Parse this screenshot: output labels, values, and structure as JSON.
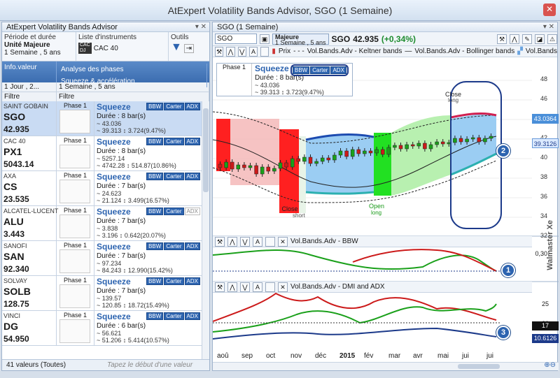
{
  "window": {
    "title": "AtExpert Volatility Bands Advisor, SGO (1 Semaine)"
  },
  "left": {
    "panel_title": "AtExpert Volatility Bands Advisor",
    "period_label": "Période et durée",
    "period_value1": "Unité Majeure",
    "period_value2": "1 Semaine , 5 ans",
    "instruments_label": "Liste d'instruments",
    "instrument_value": "CAC 40",
    "instrument_badge1": "CAC",
    "instrument_badge2": "DJ",
    "tools_label": "Outils",
    "col1": "Info.valeur",
    "col2a": "Analyse des phases",
    "col2b": "Squeeze & accélération",
    "sub1": "1 Jour , 2...",
    "sub2": "1 Semaine , 5 ans",
    "filter1": "Filtre",
    "filter2": "Filtre",
    "status": "41 valeurs (Toutes)",
    "hint": "Tapez le début d'une valeur",
    "phase_label": "Phase 1",
    "squeeze_label": "Squeeze",
    "tag_bbw": "BBW",
    "tag_carter": "Carter",
    "tag_adx": "ADX",
    "items": [
      {
        "name": "SAINT GOBAIN",
        "ticker": "SGO",
        "price": "42.935",
        "dur": "Durée : 8 bar(s)",
        "v1": "43.036",
        "v2": "39.313",
        "chg": "3.724(9.47%)"
      },
      {
        "name": "CAC 40",
        "ticker": "PX1",
        "price": "5043.14",
        "dur": "Durée : 8 bar(s)",
        "v1": "5257.14",
        "v2": "4742.28",
        "chg": "514.87(10.86%)"
      },
      {
        "name": "AXA",
        "ticker": "CS",
        "price": "23.535",
        "dur": "Durée : 7 bar(s)",
        "v1": "24.623",
        "v2": "21.124",
        "chg": "3.499(16.57%)"
      },
      {
        "name": "ALCATEL-LUCENT",
        "ticker": "ALU",
        "price": "3.443",
        "dur": "Durée : 7 bar(s)",
        "v1": "3.838",
        "v2": "3.196",
        "chg": "0.642(20.07%)"
      },
      {
        "name": "SANOFI",
        "ticker": "SAN",
        "price": "92.340",
        "dur": "Durée : 7 bar(s)",
        "v1": "97.234",
        "v2": "84.243",
        "chg": "12.990(15.42%)"
      },
      {
        "name": "SOLVAY",
        "ticker": "SOLB",
        "price": "128.75",
        "dur": "Durée : 7 bar(s)",
        "v1": "139.57",
        "v2": "120.85",
        "chg": "18.72(15.49%)"
      },
      {
        "name": "VINCI",
        "ticker": "DG",
        "price": "54.950",
        "dur": "Durée : 6 bar(s)",
        "v1": "56.621",
        "v2": "51.206",
        "chg": "5.414(10.57%)"
      }
    ]
  },
  "right": {
    "title": "SGO (1 Semaine)",
    "input_value": "SGO",
    "unit_label": "Majeure",
    "unit_sub": "1 Semaine , 5 ans",
    "ticker": "SGO",
    "price": "42.935",
    "change": "(+0,34%)",
    "legend_prix": "Prix",
    "legend_keltner": "Vol.Bands.Adv - Keltner bands",
    "legend_bollinger": "Vol.Bands.Adv - Bollinger bands",
    "legend_extra": "Vol.Bands",
    "phase_label": "Phase 1",
    "squeeze": "Squeeze",
    "dur": "Durée : 8 bar(s)",
    "v1": "43.036",
    "v2": "39.313",
    "chg": "3.723(9.47%)",
    "tag_bbw": "BBW",
    "tag_carter": "Carter",
    "tag_adx": "ADX",
    "close_long": "Close",
    "close_long2": "long",
    "close_short": "Close",
    "close_short2": "short",
    "open_long": "Open",
    "open_long2": "long",
    "price_tag": "43.0364",
    "price_tag2": "39.3126",
    "y_labels": [
      "48",
      "46",
      "44",
      "42",
      "40",
      "38",
      "36",
      "34",
      "32"
    ],
    "bbw_title": "Vol.Bands.Adv - BBW",
    "bbw_label": "0,30",
    "dmi_title": "Vol.Bands.Adv - DMI and ADX",
    "dmi_y": [
      "25",
      "20"
    ],
    "dmi_tag1": "17",
    "dmi_tag2": "10.6126",
    "watermark": "Walmaster Xe",
    "x_labels": [
      "aoû",
      "sep",
      "oct",
      "nov",
      "déc",
      "2015",
      "fév",
      "mar",
      "avr",
      "mai",
      "jui",
      "jui"
    ],
    "annotations": [
      "1",
      "2",
      "3"
    ]
  }
}
